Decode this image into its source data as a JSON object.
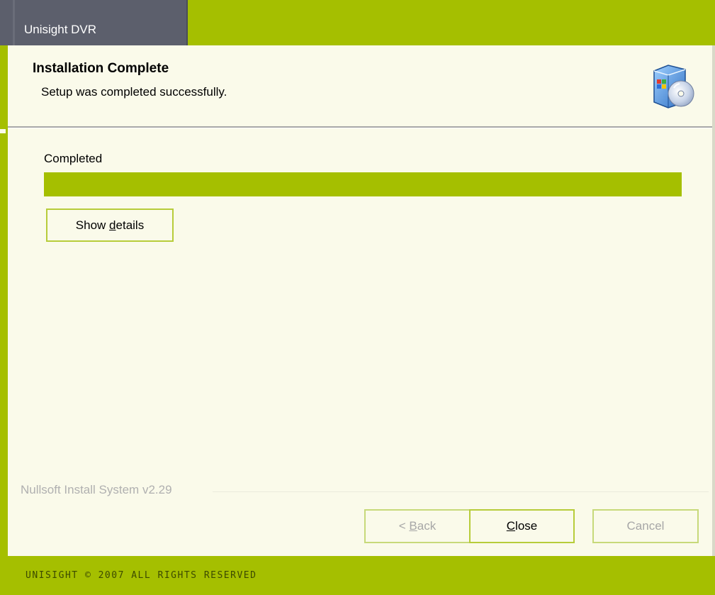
{
  "window": {
    "title": "Unisight DVR"
  },
  "header": {
    "title": "Installation Complete",
    "subtitle": "Setup was completed successfully.",
    "icon": "installer-cd-icon"
  },
  "main": {
    "status_label": "Completed",
    "progress_percent": 100,
    "show_details_label": "Show details"
  },
  "branding": {
    "text": "Nullsoft Install System v2.29"
  },
  "buttons": {
    "back_label": "< Back",
    "close_label": "Close",
    "cancel_label": "Cancel"
  },
  "footer": {
    "text": "UNISIGHT © 2007 ALL RIGHTS RESERVED"
  },
  "colors": {
    "accent": "#a5bf00",
    "background": "#fafaea",
    "title_tab": "#5c5f6c"
  }
}
